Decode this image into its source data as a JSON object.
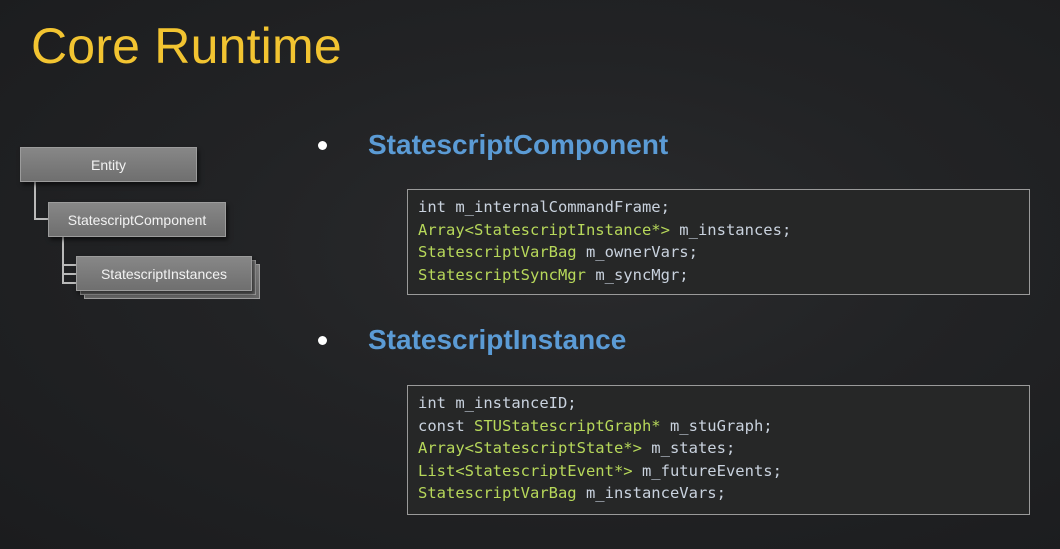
{
  "slide": {
    "title": "Core Runtime"
  },
  "diagram": {
    "nodes": [
      {
        "label": "Entity"
      },
      {
        "label": "StatescriptComponent"
      },
      {
        "label": "StatescriptInstances"
      }
    ]
  },
  "sections": [
    {
      "title": "StatescriptComponent",
      "code": [
        {
          "prefix": "int ",
          "type": "",
          "rest": "m_internalCommandFrame;"
        },
        {
          "prefix": "",
          "type": "Array<StatescriptInstance*>",
          "rest": " m_instances;"
        },
        {
          "prefix": "",
          "type": "StatescriptVarBag",
          "rest": " m_ownerVars;"
        },
        {
          "prefix": "",
          "type": "StatescriptSyncMgr",
          "rest": " m_syncMgr;"
        }
      ]
    },
    {
      "title": "StatescriptInstance",
      "code": [
        {
          "prefix": "int ",
          "type": "",
          "rest": "m_instanceID;"
        },
        {
          "prefix": "const ",
          "type": "STUStatescriptGraph*",
          "rest": " m_stuGraph;"
        },
        {
          "prefix": "",
          "type": "Array<StatescriptState*>",
          "rest": " m_states;"
        },
        {
          "prefix": "",
          "type": "List<StatescriptEvent*>",
          "rest": " m_futureEvents;"
        },
        {
          "prefix": "",
          "type": "StatescriptVarBag",
          "rest": " m_instanceVars;"
        }
      ]
    }
  ],
  "colors": {
    "title": "#f2c431",
    "heading": "#5b9bd5",
    "code_type": "#b7d85a",
    "code_text": "#c9d2de"
  }
}
